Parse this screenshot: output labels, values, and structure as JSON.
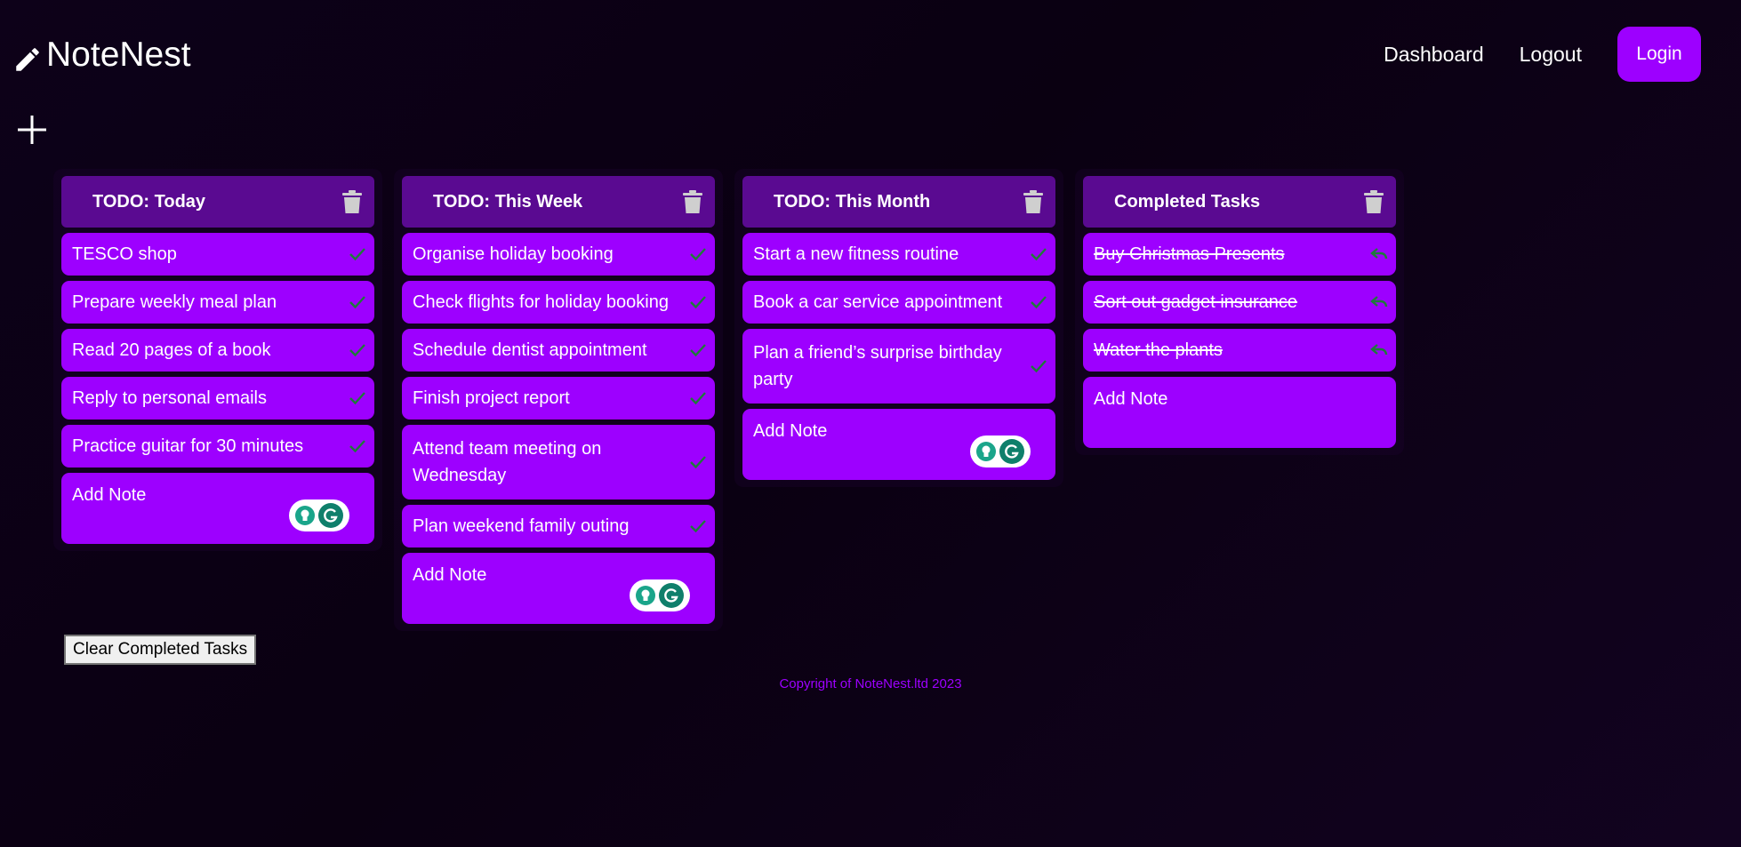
{
  "app": {
    "brand_name": "NoteNest"
  },
  "nav": {
    "dashboard_label": "Dashboard",
    "logout_label": "Logout",
    "login_label": "Login"
  },
  "colors": {
    "accent": "#9d00ff",
    "header": "#5a0a91",
    "check": "#1f7a3a"
  },
  "icons": {
    "brand": "pencil-icon",
    "add_list": "plus-icon",
    "delete_list": "trash-icon",
    "complete": "check-icon",
    "undo": "undo-icon",
    "extension": "grammarly-icon"
  },
  "columns": [
    {
      "title": "TODO: Today",
      "notes": [
        "TESCO shop",
        "Prepare weekly meal plan",
        "Read 20 pages of a book",
        "Reply to personal emails",
        "Practice guitar for 30 minutes"
      ],
      "add_note_placeholder": "Add Note"
    },
    {
      "title": "TODO: This Week",
      "notes": [
        "Organise holiday booking",
        "Check flights for holiday booking",
        "Schedule dentist appointment",
        "Finish project report",
        "Attend team meeting on Wednesday",
        "Plan weekend family outing"
      ],
      "add_note_placeholder": "Add Note"
    },
    {
      "title": "TODO: This Month",
      "notes": [
        "Start a new fitness routine",
        "Book a car service appointment",
        "Plan a friend’s surprise birthday party"
      ],
      "add_note_placeholder": "Add Note"
    },
    {
      "title": "Completed Tasks",
      "notes": [
        "Buy Christmas Presents",
        "Sort out gadget insurance",
        "Water the plants"
      ],
      "add_note_placeholder": "Add Note"
    }
  ],
  "actions": {
    "clear_completed_label": "Clear Completed Tasks"
  },
  "footer": {
    "copyright": "Copyright of NoteNest.ltd 2023"
  }
}
